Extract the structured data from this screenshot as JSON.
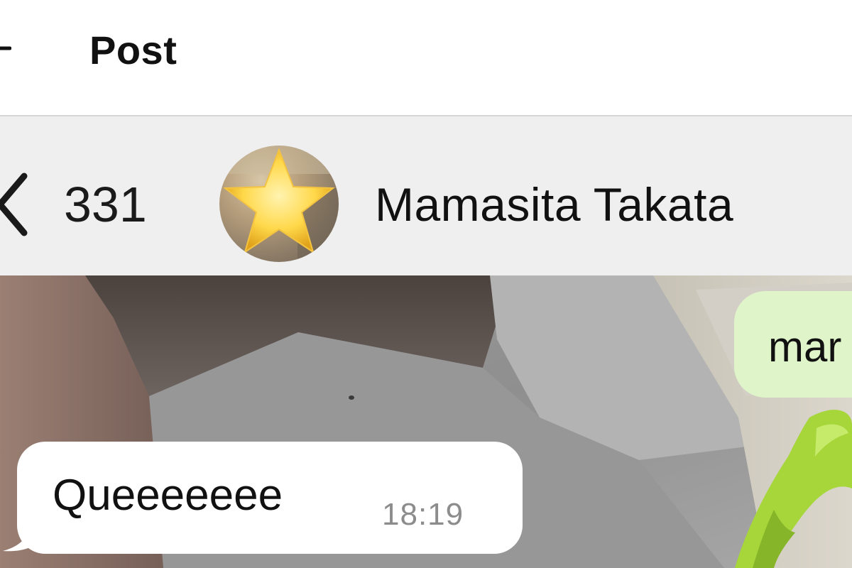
{
  "post_header": {
    "title": "Post",
    "back_icon": "back-arrow-icon"
  },
  "chat_header": {
    "unread_count": "331",
    "back_icon": "chevron-left-icon",
    "contact_name": "Mamasita Takata",
    "avatar_icon": "star-emoji-avatar"
  },
  "messages": [
    {
      "direction": "outgoing",
      "text": "mar"
    },
    {
      "direction": "incoming",
      "text": "Queeeeeee",
      "time": "18:19"
    }
  ],
  "colors": {
    "outgoing_bubble": "#dff5c9",
    "incoming_bubble": "#ffffff",
    "nav_background": "#efefef",
    "sticker_accent": "#a6d63a"
  }
}
